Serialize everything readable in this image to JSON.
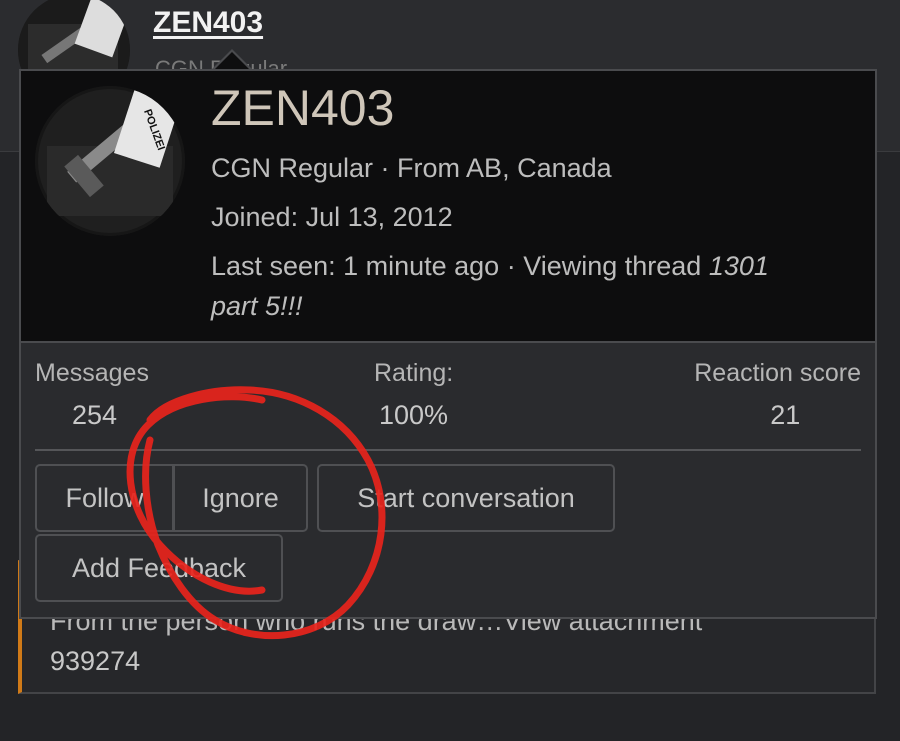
{
  "header": {
    "username": "ZEN403",
    "subline": "CGN Regular"
  },
  "popup": {
    "username": "ZEN403",
    "title_line": "CGN Regular · From AB, Canada",
    "joined": "Joined: Jul 13, 2012",
    "last_seen": "Last seen: 1 minute ago · Viewing thread ",
    "thread_name_part1": "1301",
    "thread_name_part2": "part 5!!!",
    "avatar_text": "POLIZEI",
    "stats": [
      {
        "label": "Messages",
        "value": "254"
      },
      {
        "label": "Rating:",
        "value": "100%"
      },
      {
        "label": "Reaction score",
        "value": "21"
      }
    ],
    "buttons": {
      "follow": "Follow",
      "ignore": "Ignore",
      "start_conversation": "Start conversation",
      "add_feedback": "Add Feedback"
    }
  },
  "background_post": {
    "line1": "From the person who runs the draw…View attachment",
    "line2": "939274"
  },
  "colors": {
    "annotation_red": "#e8241c",
    "post_accent": "#d07a18"
  }
}
